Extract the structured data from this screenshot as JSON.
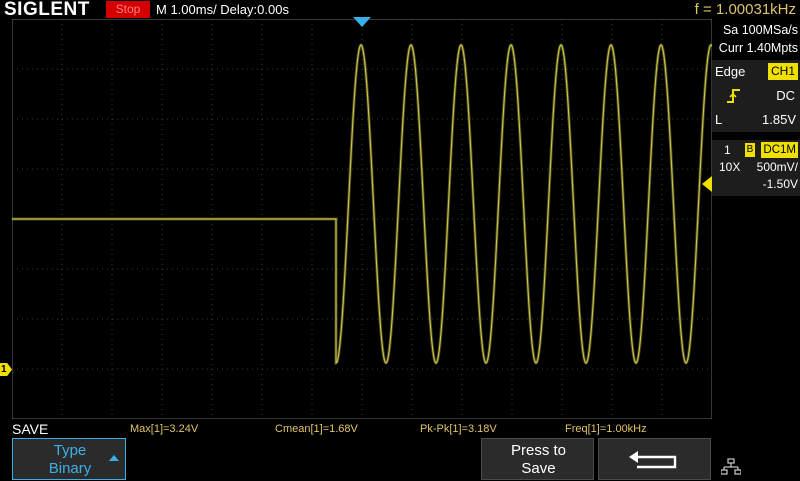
{
  "header": {
    "brand": "SIGLENT",
    "run_status": "Stop",
    "timebase": "M 1.00ms/ Delay:0.00s",
    "frequency": "f = 1.00031kHz"
  },
  "acquisition": {
    "sample_rate": "Sa 100MSa/s",
    "memory_depth": "Curr 1.40Mpts"
  },
  "trigger": {
    "type": "Edge",
    "source": "CH1",
    "coupling": "DC",
    "level_label": "L",
    "level": "1.85V"
  },
  "channel": {
    "number": "1",
    "bw_limit": "B",
    "coupling": "DC1M",
    "probe": "10X",
    "scale": "500mV/",
    "offset": "-1.50V"
  },
  "screen": {
    "channel_marker": "1"
  },
  "measurements": {
    "max": "Max[1]=3.24V",
    "cmean": "Cmean[1]=1.68V",
    "pkpk": "Pk-Pk[1]=3.18V",
    "freq": "Freq[1]=1.00kHz"
  },
  "menu": {
    "title": "SAVE",
    "type_label": "Type",
    "type_value": "Binary",
    "press_label": "Press to",
    "save_label": "Save"
  },
  "colors": {
    "trace": "#c9c24a",
    "accent": "#3bb0e8",
    "status_stop": "#d40000",
    "channel1": "#f0e000",
    "measure_text": "#e0c36a"
  },
  "chart_data": {
    "type": "line",
    "title": "",
    "xlabel": "",
    "ylabel": "",
    "x_unit": "ms",
    "y_unit": "V",
    "xlim": [
      -7,
      7
    ],
    "ylim": [
      -0.5,
      3.5
    ],
    "grid": true,
    "series": [
      {
        "segments": [
          {
            "kind": "constant",
            "x_start": -7,
            "x_end": -0.52,
            "y": 1.5
          },
          {
            "kind": "sine",
            "x_start": -0.52,
            "x_end": 7,
            "frequency_khz": 1.0,
            "amplitude": 1.59,
            "offset": 1.65,
            "start_phase_deg": -90
          }
        ]
      }
    ]
  }
}
